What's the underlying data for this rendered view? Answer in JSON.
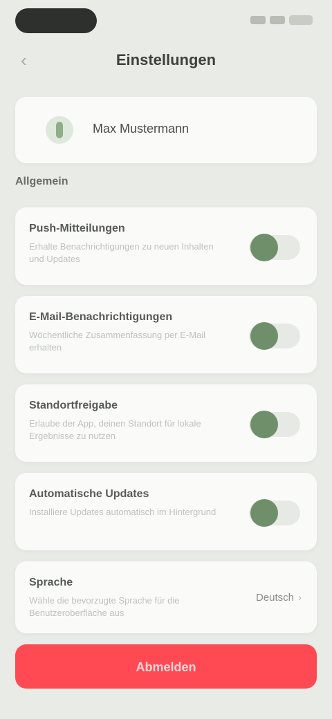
{
  "header": {
    "title": "Einstellungen",
    "back_label": "‹"
  },
  "user": {
    "name": "Max Mustermann"
  },
  "section": {
    "label": "Allgemein"
  },
  "settings": [
    {
      "title": "Push-Mitteilungen",
      "description": "Erhalte Benachrichtigungen zu neuen Inhalten und Updates",
      "enabled": true
    },
    {
      "title": "E-Mail-Benachrichtigungen",
      "description": "Wöchentliche Zusammenfassung per E-Mail erhalten",
      "enabled": true
    },
    {
      "title": "Standortfreigabe",
      "description": "Erlaube der App, deinen Standort für lokale Ergebnisse zu nutzen",
      "enabled": true
    },
    {
      "title": "Automatische Updates",
      "description": "Installiere Updates automatisch im Hintergrund",
      "enabled": true
    }
  ],
  "language": {
    "title": "Sprache",
    "description": "Wähle die bevorzugte Sprache für die Benutzeroberfläche aus",
    "value": "Deutsch"
  },
  "logout": {
    "label": "Abmelden"
  },
  "icons": {
    "back": "back-icon",
    "avatar": "user-icon",
    "chevron": "chevron-down-icon"
  },
  "colors": {
    "accent": "#6f8f6a",
    "danger": "#ff4a53"
  }
}
